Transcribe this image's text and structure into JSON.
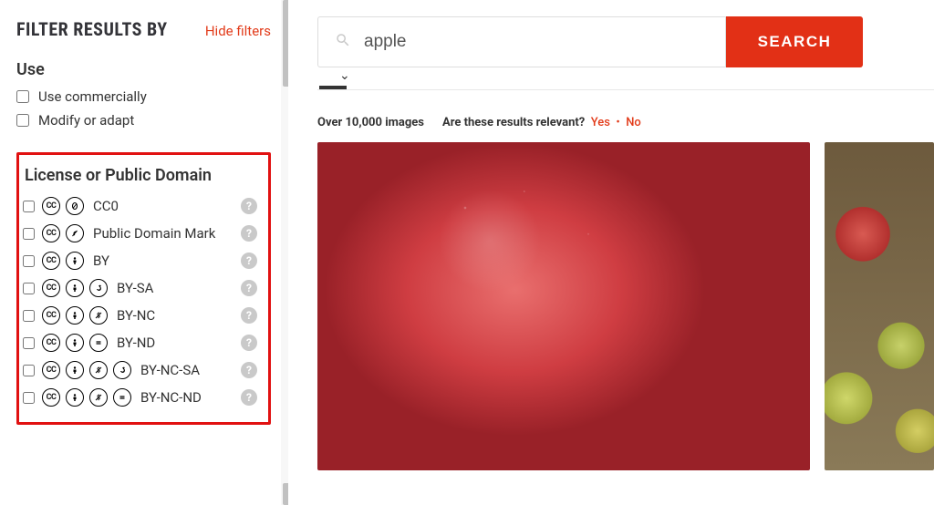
{
  "sidebar": {
    "title": "FILTER RESULTS BY",
    "hide_filters_label": "Hide filters",
    "use": {
      "heading": "Use",
      "items": [
        {
          "label": "Use commercially"
        },
        {
          "label": "Modify or adapt"
        }
      ]
    },
    "license": {
      "heading": "License or Public Domain",
      "items": [
        {
          "label": "CC0",
          "icons": [
            "cc",
            "zero"
          ]
        },
        {
          "label": "Public Domain Mark",
          "icons": [
            "cc",
            "pd"
          ]
        },
        {
          "label": "BY",
          "icons": [
            "cc",
            "by"
          ]
        },
        {
          "label": "BY-SA",
          "icons": [
            "cc",
            "by",
            "sa"
          ]
        },
        {
          "label": "BY-NC",
          "icons": [
            "cc",
            "by",
            "nc"
          ]
        },
        {
          "label": "BY-ND",
          "icons": [
            "cc",
            "by",
            "nd"
          ]
        },
        {
          "label": "BY-NC-SA",
          "icons": [
            "cc",
            "by",
            "nc",
            "sa"
          ]
        },
        {
          "label": "BY-NC-ND",
          "icons": [
            "cc",
            "by",
            "nc",
            "nd"
          ]
        }
      ]
    }
  },
  "search": {
    "query": "apple",
    "button_label": "SEARCH"
  },
  "results": {
    "count_label": "Over 10,000 images",
    "relevant_prompt": "Are these results relevant?",
    "yes": "Yes",
    "no": "No"
  },
  "colors": {
    "accent": "#e23016"
  }
}
